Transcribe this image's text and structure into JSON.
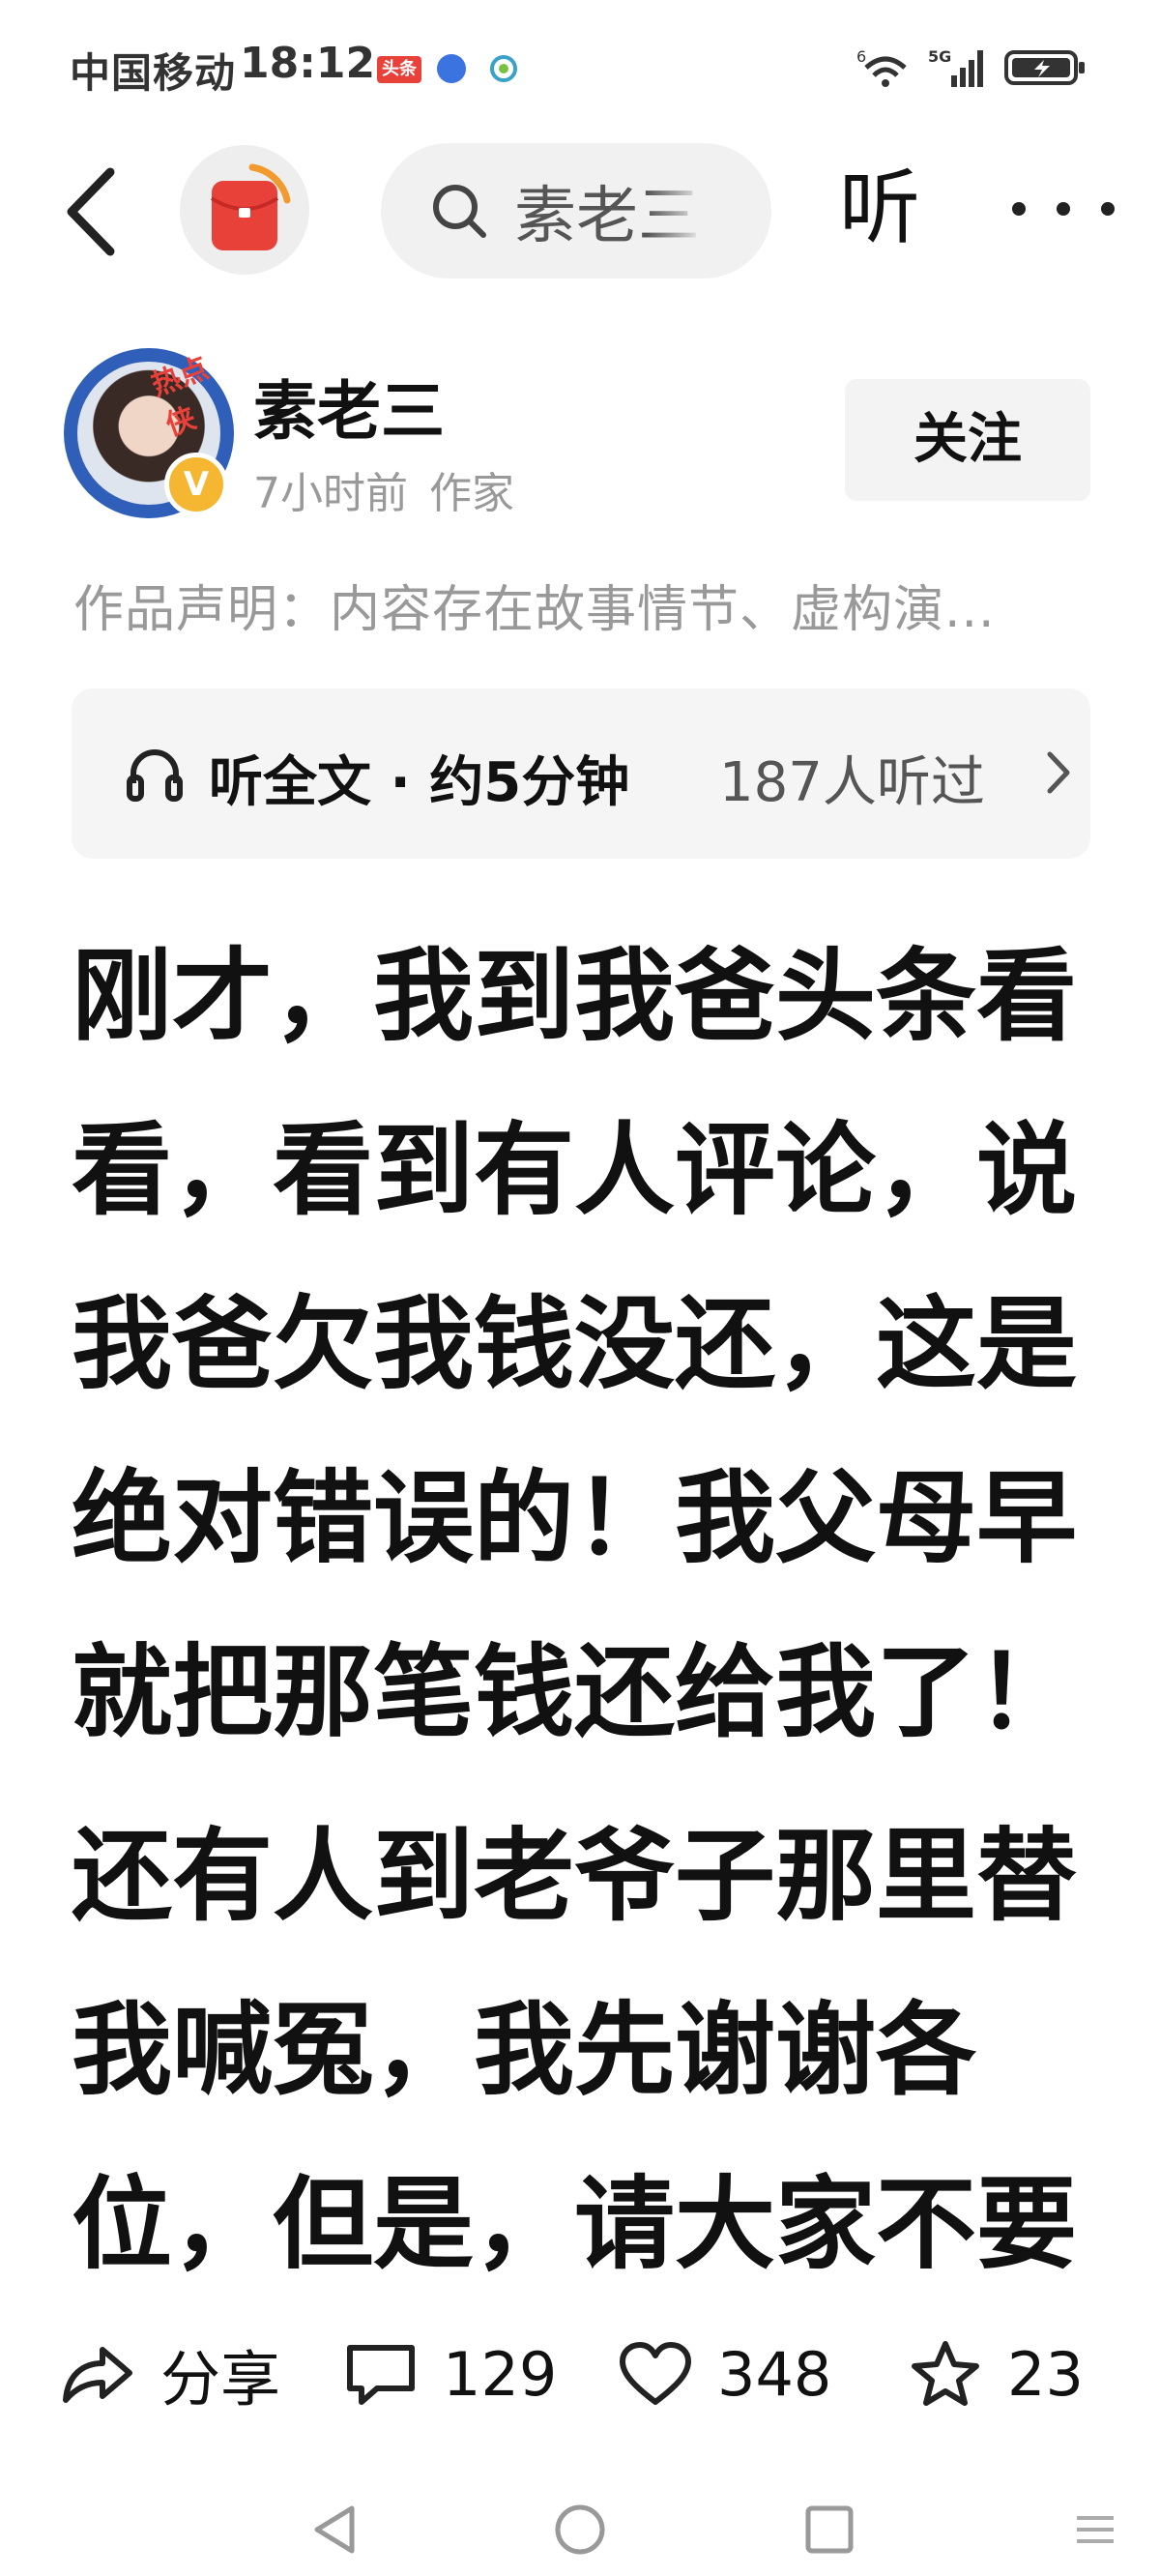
{
  "status_bar": {
    "carrier": "中国移动",
    "time": "18:12",
    "toutiao_badge": "头条",
    "network": "5G",
    "wifi_label": "6"
  },
  "nav": {
    "search_text": "素老三",
    "listen_label": "听",
    "more_label": "···"
  },
  "author": {
    "name": "素老三",
    "hot_tag": "热点侠",
    "verified_mark": "V",
    "time_ago": "7小时前",
    "role": "作家",
    "follow_label": "关注"
  },
  "declaration": "作品声明：内容存在故事情节、虚构演...",
  "listen_bar": {
    "label": "听全文 · 约5分钟",
    "count": "187人听过"
  },
  "article": {
    "paragraph_1": [
      "刚才，我到我爸头条看",
      "看，看到有人评论，说",
      "我爸欠我钱没还，这是",
      "绝对错误的！我父母早",
      "就把那笔钱还给我了！"
    ],
    "paragraph_2": [
      "还有人到老爷子那里替",
      "我喊冤，我先谢谢各",
      "位，但是，请大家不要"
    ]
  },
  "actions": {
    "share_label": "分享",
    "comment_count": "129",
    "like_count": "348",
    "favorite_count": "23"
  },
  "colors": {
    "accent_red": "#e8413a",
    "verified_gold": "#f5b731",
    "muted_text": "#999999"
  }
}
